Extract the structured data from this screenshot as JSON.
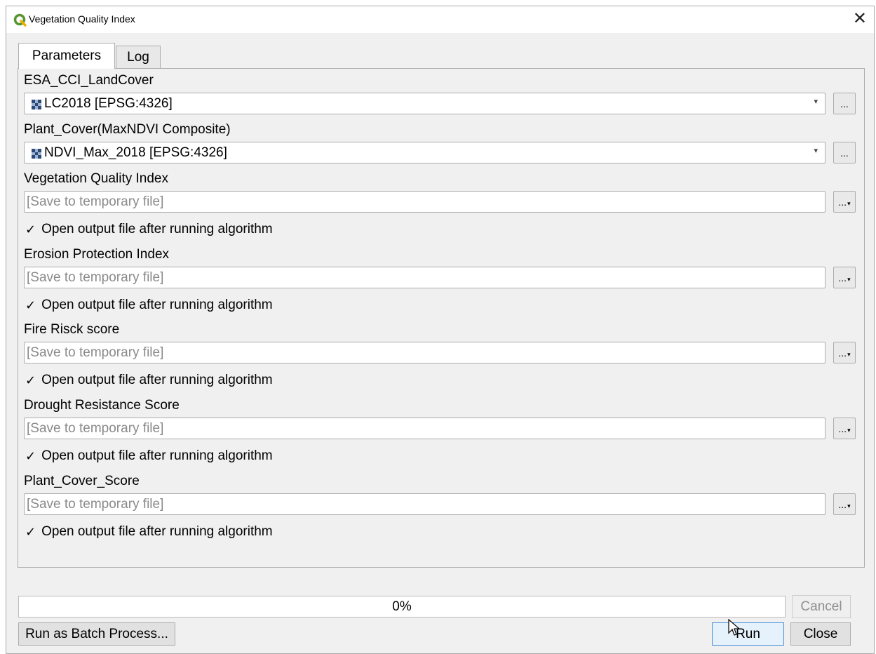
{
  "window": {
    "title": "Vegetation Quality Index",
    "close_glyph": "✕",
    "icon": "qgis-icon"
  },
  "tabs": [
    {
      "label": "Parameters",
      "active": true
    },
    {
      "label": "Log",
      "active": false
    }
  ],
  "params": {
    "landcover": {
      "label": "ESA_CCI_LandCover",
      "value": "LC2018 [EPSG:4326]"
    },
    "plant_cover": {
      "label": "Plant_Cover(MaxNDVI Composite)",
      "value": "NDVI_Max_2018 [EPSG:4326]"
    },
    "outputs": [
      {
        "label": "Vegetation Quality Index",
        "placeholder": "[Save to temporary file]",
        "open_label": "Open output file after running algorithm",
        "open_checked": true
      },
      {
        "label": "Erosion Protection Index",
        "placeholder": "[Save to temporary file]",
        "open_label": "Open output file after running algorithm",
        "open_checked": true
      },
      {
        "label": "Fire Risck score",
        "placeholder": "[Save to temporary file]",
        "open_label": "Open output file after running algorithm",
        "open_checked": true
      },
      {
        "label": "Drought Resistance Score",
        "placeholder": "[Save to temporary file]",
        "open_label": "Open output file after running algorithm",
        "open_checked": true
      },
      {
        "label": "Plant_Cover_Score",
        "placeholder": "[Save to temporary file]",
        "open_label": "Open output file after running algorithm",
        "open_checked": true
      }
    ],
    "browse_label": "...",
    "checkmark": "✓"
  },
  "progress": {
    "text": "0%",
    "value": 0
  },
  "buttons": {
    "cancel": "Cancel",
    "batch": "Run as Batch Process...",
    "run": "Run",
    "close": "Close"
  },
  "colors": {
    "accent": "#4a90d9",
    "qgis_green": "#589632",
    "qgis_yellow": "#eeb000"
  }
}
